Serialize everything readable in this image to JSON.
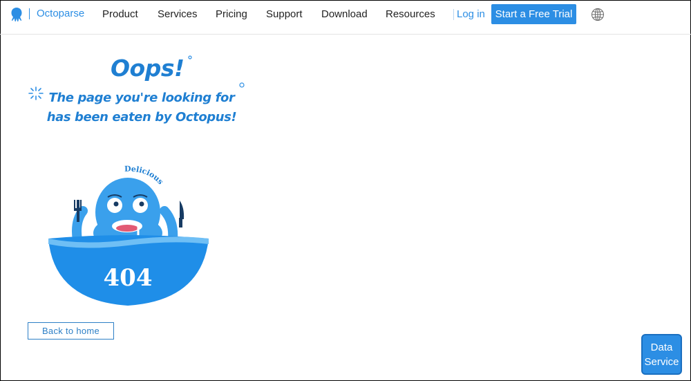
{
  "header": {
    "brand": "Octoparse",
    "nav": [
      "Product",
      "Services",
      "Pricing",
      "Support",
      "Download",
      "Resources"
    ],
    "login": "Log in",
    "trial_button": "Start a Free Trial",
    "globe_icon": "globe-icon",
    "logo_icon": "octopus-logo-icon"
  },
  "error": {
    "title": "Oops!",
    "line1": "The page you're looking for",
    "line2": "has been eaten by Octopus!",
    "illustration_text": "Delicious",
    "code": "404"
  },
  "actions": {
    "back_home": "Back to home",
    "data_service_line1": "Data",
    "data_service_line2": "Service"
  },
  "colors": {
    "accent": "#2c8ee4",
    "octopus": "#2f9be8",
    "bowl": "#1f8ee8"
  }
}
